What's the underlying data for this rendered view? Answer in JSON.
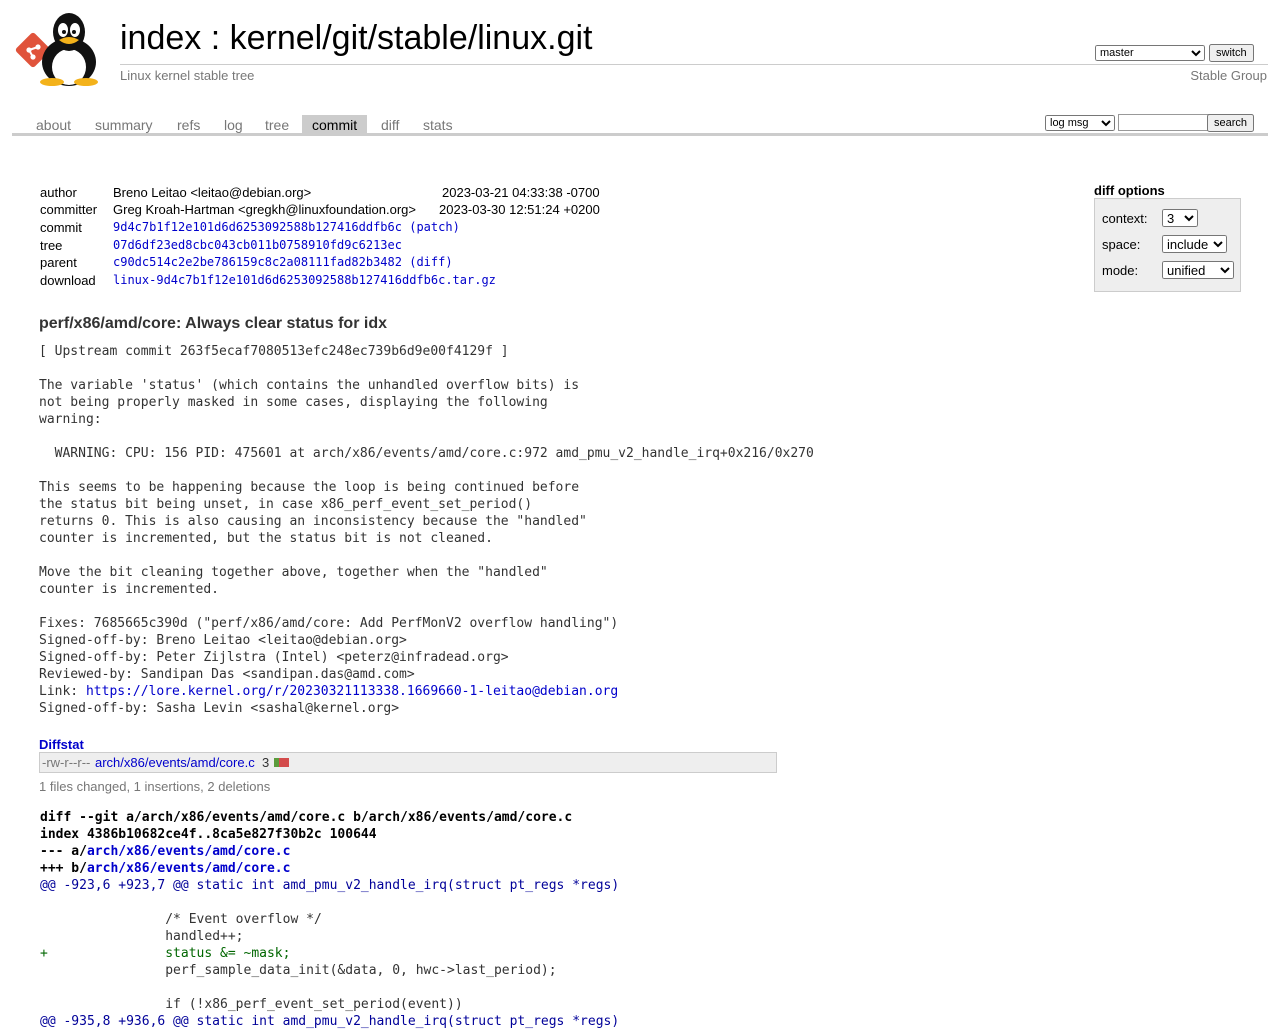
{
  "header": {
    "title_index": "index",
    "title_sep": " : ",
    "title_repo": "kernel/git/stable/linux.git",
    "subtitle": "Linux kernel stable tree",
    "owner": "Stable Group",
    "branch_selected": "master",
    "switch_label": "switch"
  },
  "tabs": [
    {
      "label": "about"
    },
    {
      "label": "summary"
    },
    {
      "label": "refs"
    },
    {
      "label": "log"
    },
    {
      "label": "tree"
    },
    {
      "label": "commit"
    },
    {
      "label": "diff"
    },
    {
      "label": "stats"
    }
  ],
  "active_tab": "commit",
  "search": {
    "mode_selected": "log msg",
    "query": "",
    "button_label": "search"
  },
  "commit_info": {
    "author_label": "author",
    "author": "Breno Leitao <leitao@debian.org>",
    "author_date": "2023-03-21 04:33:38 -0700",
    "committer_label": "committer",
    "committer": "Greg Kroah-Hartman <gregkh@linuxfoundation.org>",
    "committer_date": "2023-03-30 12:51:24 +0200",
    "commit_label": "commit",
    "commit_hash": "9d4c7b1f12e101d6d6253092588b127416ddfb6c",
    "patch_link": "(patch)",
    "tree_label": "tree",
    "tree_hash": "07d6df23ed8cbc043cb011b0758910fd9c6213ec",
    "parent_label": "parent",
    "parent_hash": "c90dc514c2e2be786159c8c2a08111fad82b3482",
    "diff_link": "(diff)",
    "download_label": "download",
    "download_file": "linux-9d4c7b1f12e101d6d6253092588b127416ddfb6c.tar.gz"
  },
  "diff_options": {
    "title": "diff options",
    "context_label": "context:",
    "context_value": "3",
    "space_label": "space:",
    "space_value": "include",
    "mode_label": "mode:",
    "mode_value": "unified"
  },
  "subject": "perf/x86/amd/core: Always clear status for idx",
  "message": "[ Upstream commit 263f5ecaf7080513efc248ec739b6d9e00f4129f ]\n\nThe variable 'status' (which contains the unhandled overflow bits) is\nnot being properly masked in some cases, displaying the following\nwarning:\n\n  WARNING: CPU: 156 PID: 475601 at arch/x86/events/amd/core.c:972 amd_pmu_v2_handle_irq+0x216/0x270\n\nThis seems to be happening because the loop is being continued before\nthe status bit being unset, in case x86_perf_event_set_period()\nreturns 0. This is also causing an inconsistency because the \"handled\"\ncounter is incremented, but the status bit is not cleaned.\n\nMove the bit cleaning together above, together when the \"handled\"\ncounter is incremented.\n\nFixes: 7685665c390d (\"perf/x86/amd/core: Add PerfMonV2 overflow handling\")\nSigned-off-by: Breno Leitao <leitao@debian.org>\nSigned-off-by: Peter Zijlstra (Intel) <peterz@infradead.org>\nReviewed-by: Sandipan Das <sandipan.das@amd.com>\nLink: ",
  "message_link": "https://lore.kernel.org/r/20230321113338.1669660-1-leitao@debian.org",
  "message_tail": "\nSigned-off-by: Sasha Levin <sashal@kernel.org>",
  "diffstat": {
    "header": "Diffstat",
    "mode": "-rw-r--r--",
    "file": "arch/x86/events/amd/core.c",
    "count": "3",
    "insertions": 1,
    "deletions": 2,
    "summary": "1 files changed, 1 insertions, 2 deletions",
    "colors": {
      "add": "#5b9b3b",
      "del": "#d34b4b"
    }
  },
  "diff": {
    "line1_prefix": "diff --git a/arch/x86/events/amd/core.c b/arch/x86/events/amd/core.c",
    "line2": "index 4386b10682ce4f..8ca5e827f30b2c 100644",
    "line3_prefix": "--- a/",
    "line3_link": "arch/x86/events/amd/core.c",
    "line4_prefix": "+++ b/",
    "line4_link": "arch/x86/events/amd/core.c",
    "hunk1": "@@ -923,6 +923,7 @@ static int amd_pmu_v2_handle_irq(struct pt_regs *regs)",
    "body": [
      {
        "type": "ctx",
        "text": " "
      },
      {
        "type": "ctx",
        "text": " \t\t/* Event overflow */"
      },
      {
        "type": "ctx",
        "text": " \t\thandled++;"
      },
      {
        "type": "add",
        "text": "+\t\tstatus &= ~mask;"
      },
      {
        "type": "ctx",
        "text": " \t\tperf_sample_data_init(&data, 0, hwc->last_period);"
      },
      {
        "type": "ctx",
        "text": " "
      },
      {
        "type": "ctx",
        "text": " \t\tif (!x86_perf_event_set_period(event))"
      }
    ],
    "hunk2": "@@ -935,8 +936,6 @@ static int amd_pmu_v2_handle_irq(struct pt_regs *regs)"
  }
}
